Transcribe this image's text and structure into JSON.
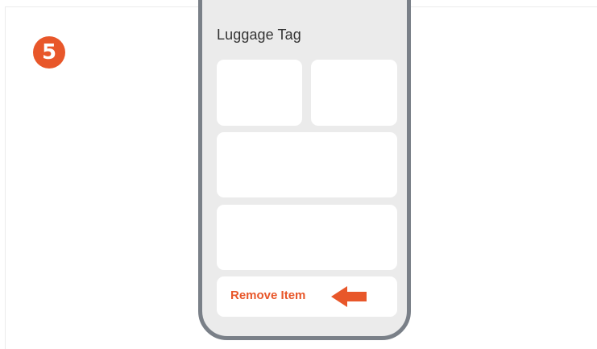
{
  "step": {
    "number": "5"
  },
  "screen": {
    "title": "Luggage Tag",
    "remove_label": "Remove Item"
  },
  "icons": {
    "pointer": "left-arrow-icon"
  },
  "colors": {
    "accent": "#e8572a",
    "phone_border": "#7a8088",
    "screen_background": "#ebebeb",
    "card_background": "#ffffff",
    "title_text": "#333333"
  }
}
